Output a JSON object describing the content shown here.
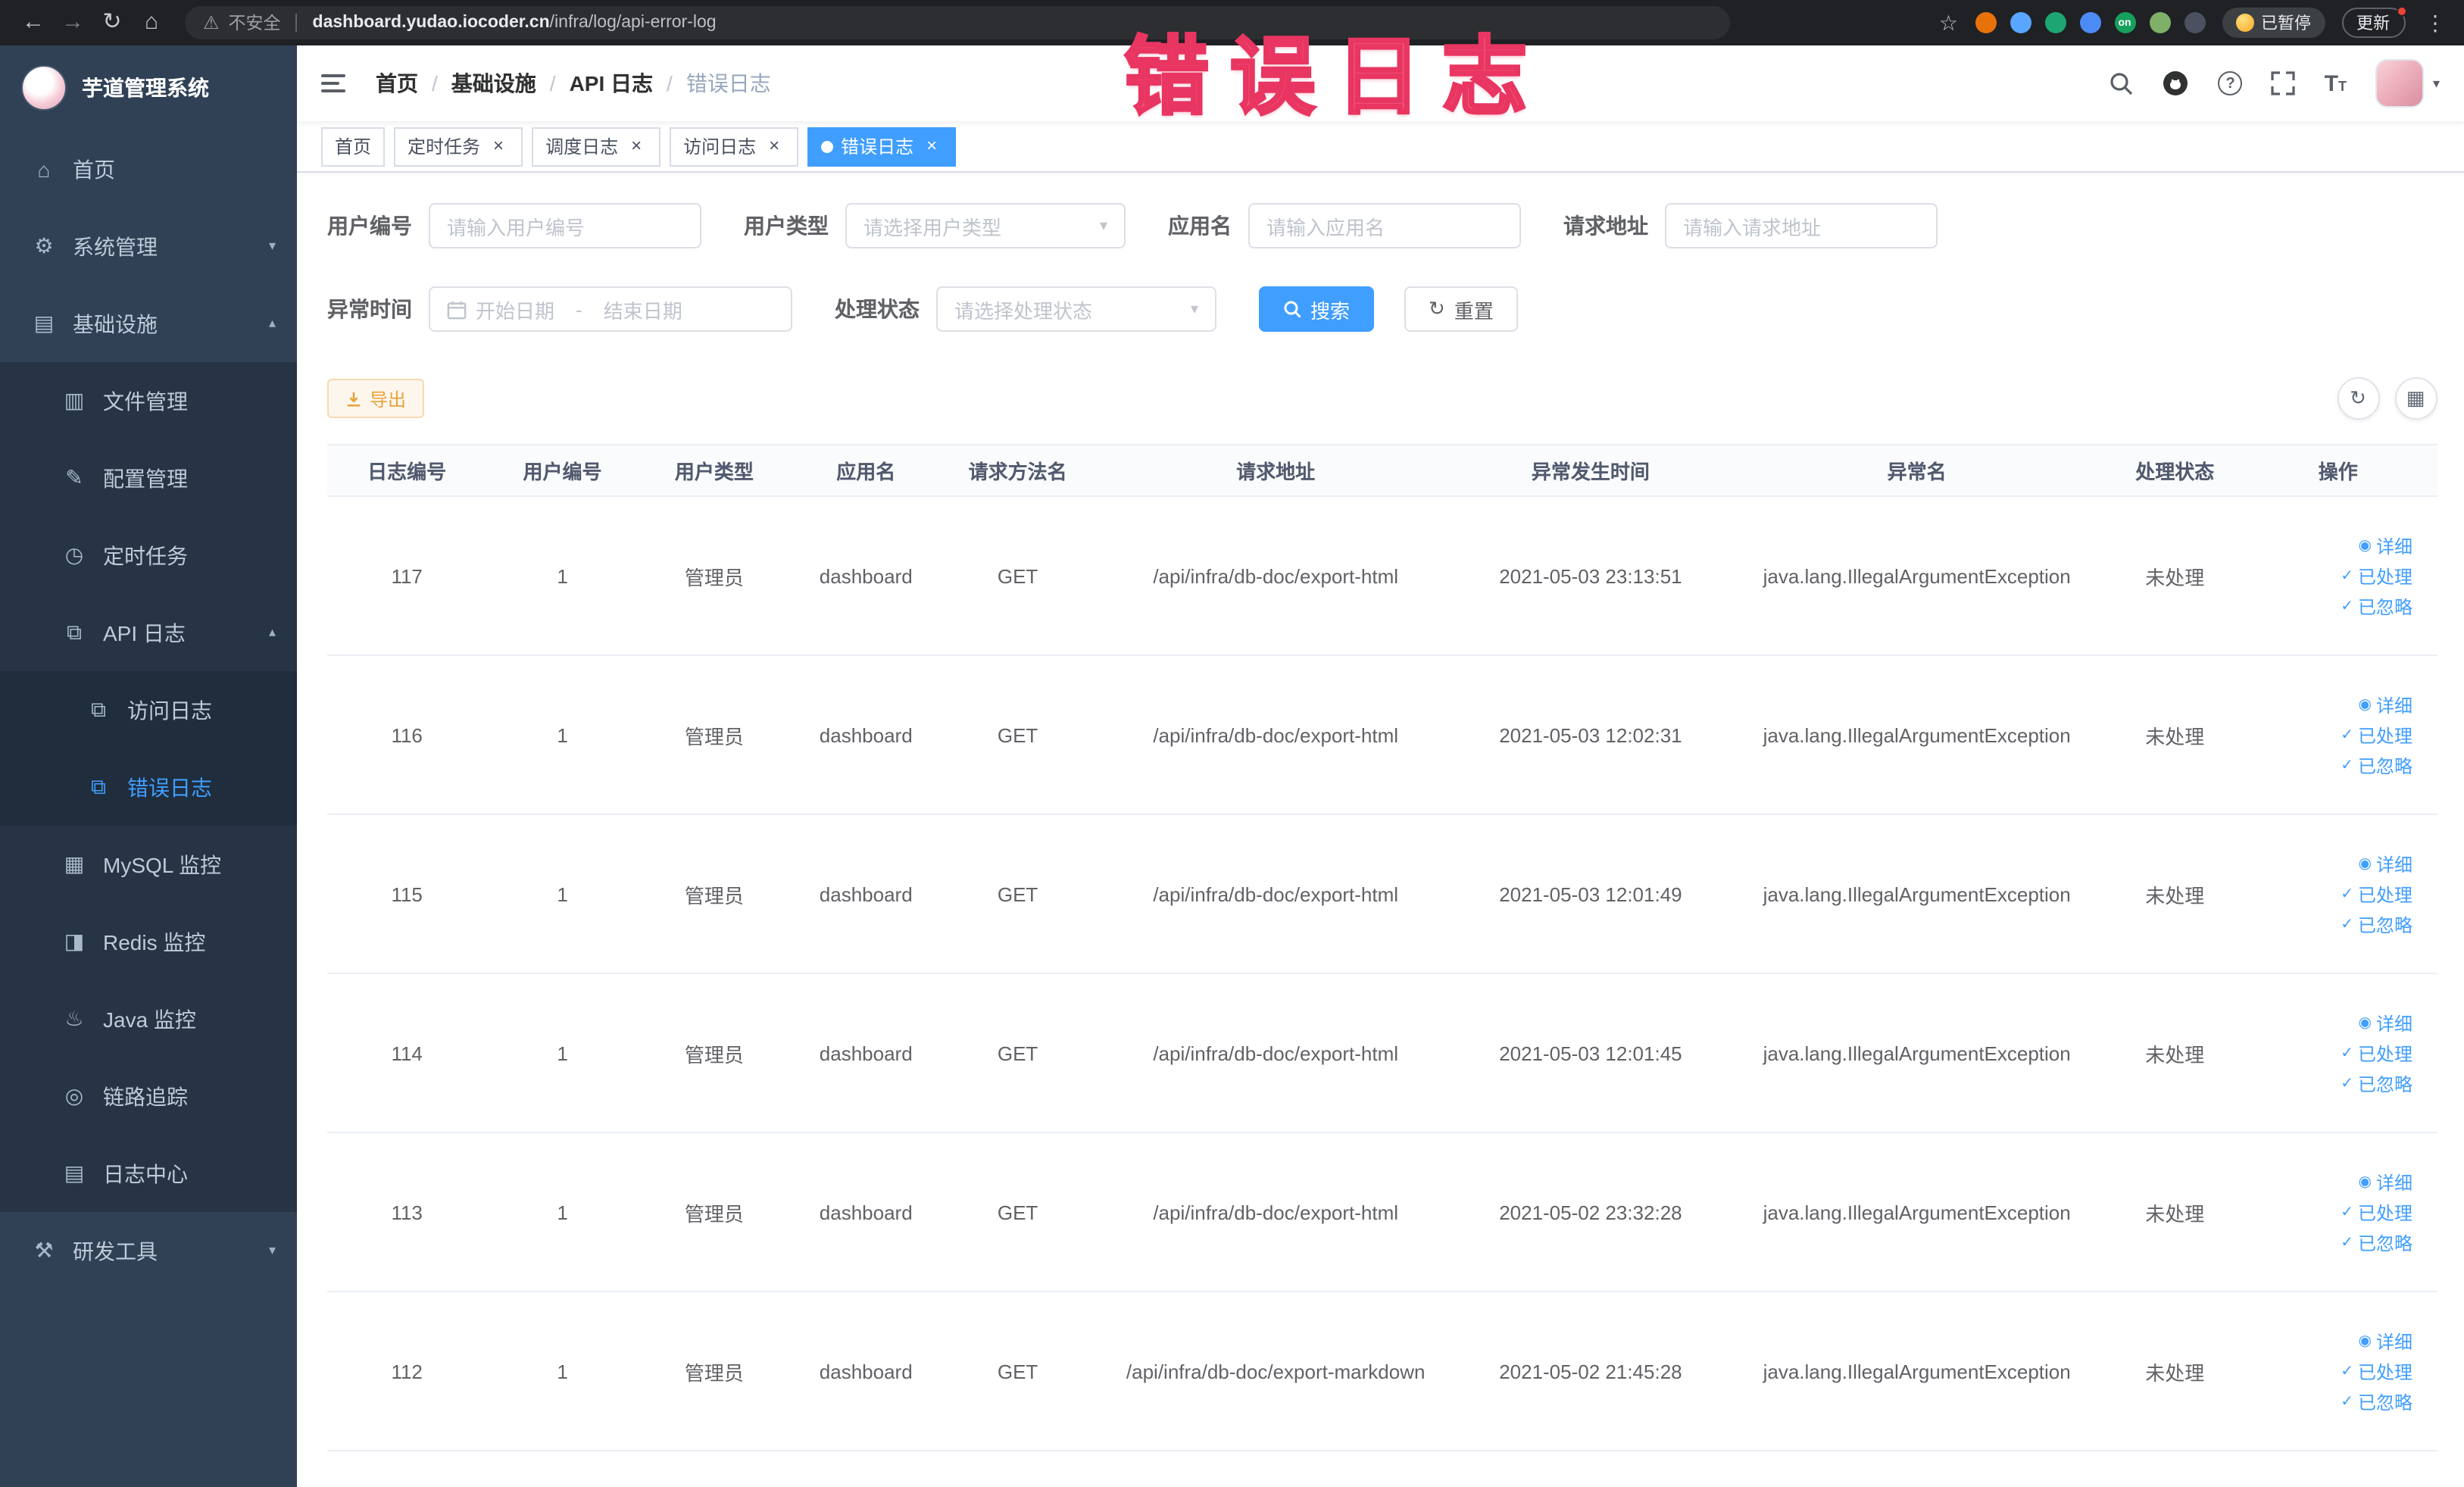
{
  "annotation": {
    "text": "错误日志"
  },
  "browser": {
    "security_text": "不安全",
    "url_domain": "dashboard.yudao.iocoder.cn",
    "url_path": "/infra/log/api-error-log",
    "paused_label": "已暂停",
    "update_label": "更新",
    "nav_icons": {
      "back": "←",
      "forward": "→",
      "reload": "↻",
      "home": "⌂",
      "warning": "⚠",
      "star": "☆",
      "menu": "⋮"
    },
    "extensions": [
      {
        "key": "orange-circle",
        "color": "#e8710a",
        "text": ""
      },
      {
        "key": "water-drop",
        "color": "#58a6ff",
        "text": ""
      },
      {
        "key": "green-circle",
        "color": "#1ea672",
        "text": ""
      },
      {
        "key": "blue-grid",
        "color": "#4c8bf5",
        "text": ""
      },
      {
        "key": "on-badge",
        "color": "#16a05d",
        "text": "on"
      },
      {
        "key": "leaf",
        "color": "#7fb069",
        "text": ""
      },
      {
        "key": "dark-puzzle",
        "color": "#4a5160",
        "text": ""
      }
    ]
  },
  "sidebar": {
    "logo_title": "芋道管理系统",
    "items": [
      {
        "key": "home",
        "label": "首页",
        "icon": "⌂",
        "level": 0,
        "active": false,
        "arrow": null
      },
      {
        "key": "system-mgmt",
        "label": "系统管理",
        "icon": "⚙",
        "level": 0,
        "active": false,
        "arrow": "down"
      },
      {
        "key": "infrastructure",
        "label": "基础设施",
        "icon": "▤",
        "level": 0,
        "active": false,
        "arrow": "up"
      },
      {
        "key": "file-mgmt",
        "label": "文件管理",
        "icon": "▥",
        "level": 1,
        "active": false,
        "arrow": null
      },
      {
        "key": "config-mgmt",
        "label": "配置管理",
        "icon": "✎",
        "level": 1,
        "active": false,
        "arrow": null
      },
      {
        "key": "scheduled-jobs",
        "label": "定时任务",
        "icon": "◷",
        "level": 1,
        "active": false,
        "arrow": null
      },
      {
        "key": "api-log",
        "label": "API 日志",
        "icon": "⧉",
        "level": 1,
        "active": false,
        "arrow": "up"
      },
      {
        "key": "access-log",
        "label": "访问日志",
        "icon": "⧉",
        "level": 2,
        "active": false,
        "arrow": null
      },
      {
        "key": "error-log",
        "label": "错误日志",
        "icon": "⧉",
        "level": 2,
        "active": true,
        "arrow": null
      },
      {
        "key": "mysql-monitor",
        "label": "MySQL 监控",
        "icon": "▦",
        "level": 1,
        "active": false,
        "arrow": null
      },
      {
        "key": "redis-monitor",
        "label": "Redis 监控",
        "icon": "◨",
        "level": 1,
        "active": false,
        "arrow": null
      },
      {
        "key": "java-monitor",
        "label": "Java 监控",
        "icon": "♨",
        "level": 1,
        "active": false,
        "arrow": null
      },
      {
        "key": "trace",
        "label": "链路追踪",
        "icon": "◎",
        "level": 1,
        "active": false,
        "arrow": null
      },
      {
        "key": "log-center",
        "label": "日志中心",
        "icon": "▤",
        "level": 1,
        "active": false,
        "arrow": null
      },
      {
        "key": "dev-tools",
        "label": "研发工具",
        "icon": "⚒",
        "level": 0,
        "active": false,
        "arrow": "down"
      }
    ]
  },
  "header": {
    "breadcrumb": [
      "首页",
      "基础设施",
      "API 日志",
      "错误日志"
    ],
    "help_icon_text": "?",
    "font_size_icon": "T",
    "caret": "▾"
  },
  "tabs": [
    {
      "key": "home",
      "label": "首页",
      "closable": false,
      "active": false
    },
    {
      "key": "scheduled-jobs",
      "label": "定时任务",
      "closable": true,
      "active": false
    },
    {
      "key": "job-log",
      "label": "调度日志",
      "closable": true,
      "active": false
    },
    {
      "key": "access-log",
      "label": "访问日志",
      "closable": true,
      "active": false
    },
    {
      "key": "error-log",
      "label": "错误日志",
      "closable": true,
      "active": true
    }
  ],
  "filters": {
    "user_id_label": "用户编号",
    "user_id_placeholder": "请输入用户编号",
    "user_type_label": "用户类型",
    "user_type_placeholder": "请选择用户类型",
    "app_name_label": "应用名",
    "app_name_placeholder": "请输入应用名",
    "request_url_label": "请求地址",
    "request_url_placeholder": "请输入请求地址",
    "exception_time_label": "异常时间",
    "start_date_placeholder": "开始日期",
    "range_separator": "-",
    "end_date_placeholder": "结束日期",
    "process_status_label": "处理状态",
    "process_status_placeholder": "请选择处理状态",
    "search_label": "搜索",
    "reset_label": "重置",
    "export_label": "导出",
    "select_arrow": "▾",
    "reset_icon": "↻",
    "refresh_icon": "↻",
    "grid_icon": "▦"
  },
  "table": {
    "columns": [
      "日志编号",
      "用户编号",
      "用户类型",
      "应用名",
      "请求方法名",
      "请求地址",
      "异常发生时间",
      "异常名",
      "处理状态",
      "操作"
    ],
    "actions": [
      {
        "key": "detail",
        "label": "详细",
        "icon": "◉",
        "icon_name": "eye-icon"
      },
      {
        "key": "processed",
        "label": "已处理",
        "icon": "✓",
        "icon_name": "check-icon"
      },
      {
        "key": "ignored",
        "label": "已忽略",
        "icon": "✓",
        "icon_name": "check-icon"
      }
    ],
    "rows": [
      {
        "id": "117",
        "user_id": "1",
        "user_type": "管理员",
        "app": "dashboard",
        "method": "GET",
        "url": "/api/infra/db-doc/export-html",
        "time": "2021-05-03 23:13:51",
        "exception": "java.lang.IllegalArgumentException",
        "status": "未处理"
      },
      {
        "id": "116",
        "user_id": "1",
        "user_type": "管理员",
        "app": "dashboard",
        "method": "GET",
        "url": "/api/infra/db-doc/export-html",
        "time": "2021-05-03 12:02:31",
        "exception": "java.lang.IllegalArgumentException",
        "status": "未处理"
      },
      {
        "id": "115",
        "user_id": "1",
        "user_type": "管理员",
        "app": "dashboard",
        "method": "GET",
        "url": "/api/infra/db-doc/export-html",
        "time": "2021-05-03 12:01:49",
        "exception": "java.lang.IllegalArgumentException",
        "status": "未处理"
      },
      {
        "id": "114",
        "user_id": "1",
        "user_type": "管理员",
        "app": "dashboard",
        "method": "GET",
        "url": "/api/infra/db-doc/export-html",
        "time": "2021-05-03 12:01:45",
        "exception": "java.lang.IllegalArgumentException",
        "status": "未处理"
      },
      {
        "id": "113",
        "user_id": "1",
        "user_type": "管理员",
        "app": "dashboard",
        "method": "GET",
        "url": "/api/infra/db-doc/export-html",
        "time": "2021-05-02 23:32:28",
        "exception": "java.lang.IllegalArgumentException",
        "status": "未处理"
      },
      {
        "id": "112",
        "user_id": "1",
        "user_type": "管理员",
        "app": "dashboard",
        "method": "GET",
        "url": "/api/infra/db-doc/export-markdown",
        "time": "2021-05-02 21:45:28",
        "exception": "java.lang.IllegalArgumentException",
        "status": "未处理"
      }
    ]
  }
}
